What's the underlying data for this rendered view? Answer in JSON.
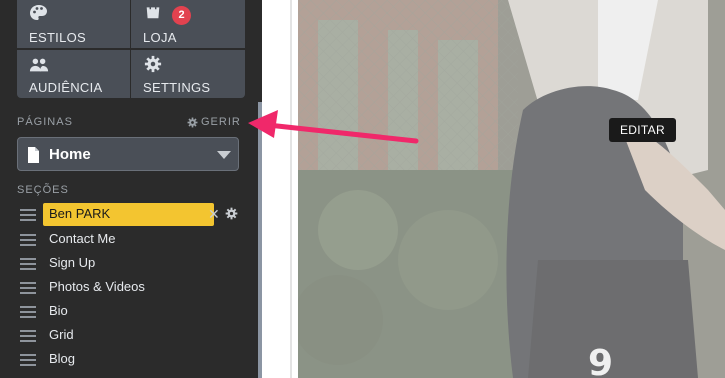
{
  "sidebar": {
    "tiles": [
      {
        "id": "estilos",
        "label": "ESTILOS",
        "icon": "palette-icon"
      },
      {
        "id": "loja",
        "label": "LOJA",
        "icon": "shopping-bag-icon",
        "badge": "2"
      },
      {
        "id": "audiencia",
        "label": "AUDIÊNCIA",
        "icon": "people-icon"
      },
      {
        "id": "settings",
        "label": "SETTINGS",
        "icon": "gear-icon"
      }
    ],
    "pages": {
      "heading": "PÁGINAS",
      "manage_label": "GERIR",
      "selected": "Home"
    },
    "sections": {
      "heading": "SEÇÕES",
      "items": [
        {
          "label": "Ben PARK",
          "active": true
        },
        {
          "label": "Contact Me"
        },
        {
          "label": "Sign Up"
        },
        {
          "label": "Photos & Videos"
        },
        {
          "label": "Bio"
        },
        {
          "label": "Grid"
        },
        {
          "label": "Blog"
        }
      ]
    }
  },
  "preview": {
    "edit_tooltip": "EDITAR"
  },
  "colors": {
    "sidebar_bg": "#2b2b2b",
    "tile_bg": "#4a4f57",
    "active_section": "#f3c530",
    "badge": "#e2424f",
    "arrow": "#f0286a"
  }
}
